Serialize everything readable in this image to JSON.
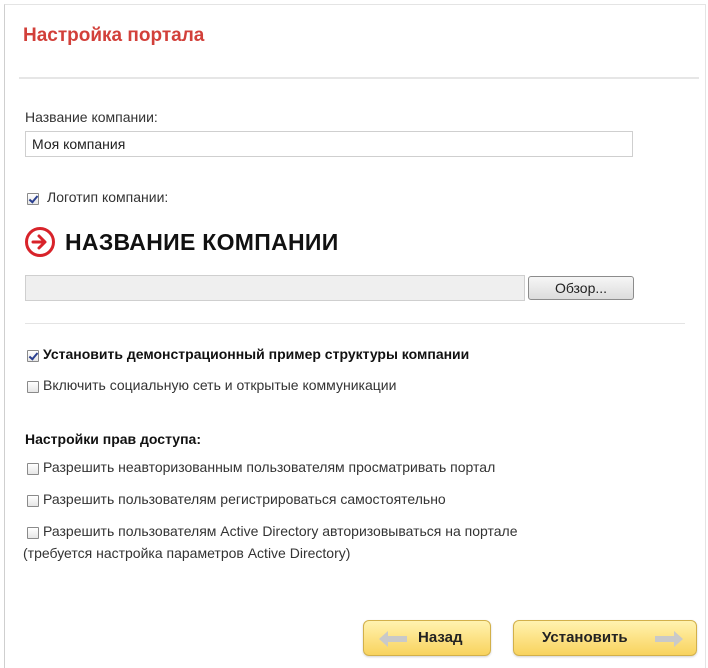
{
  "header": {
    "title": "Настройка портала"
  },
  "company": {
    "name_label": "Название компании:",
    "name_value": "Моя компания",
    "logo_label": "Логотип компании:",
    "logo_checked": true,
    "logo_text": "НАЗВАНИЕ КОМПАНИИ",
    "browse_label": "Обзор..."
  },
  "options": {
    "demo_label": "Установить демонстрационный пример структуры компании",
    "demo_checked": true,
    "social_label": "Включить социальную сеть и открытые коммуникации",
    "social_checked": false
  },
  "access": {
    "heading": "Настройки прав доступа:",
    "items": [
      {
        "label": "Разрешить неавторизованным пользователям просматривать портал",
        "checked": false
      },
      {
        "label": "Разрешить пользователям регистрироваться самостоятельно",
        "checked": false
      },
      {
        "label": "Разрешить пользователям Active Directory авторизовываться на портале",
        "checked": false
      }
    ],
    "ad_note": "(требуется настройка параметров Active Directory)"
  },
  "footer": {
    "back_label": "Назад",
    "install_label": "Установить"
  },
  "colors": {
    "title": "#d2403a",
    "logo_red": "#d8232a",
    "button_yellow": "#fde48a",
    "arrow": "#c9c9c9"
  },
  "icons": {
    "logo": "circle-arrow-right-icon",
    "back": "arrow-left-icon",
    "install": "arrow-right-icon"
  }
}
